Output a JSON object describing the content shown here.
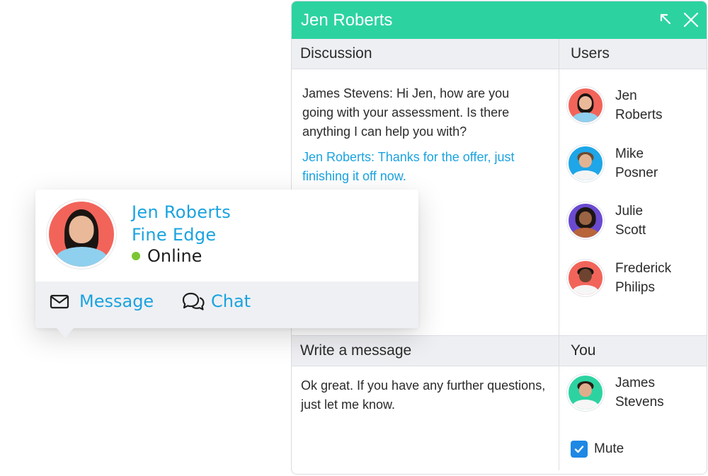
{
  "window": {
    "title": "Jen Roberts",
    "accent_color": "#2cd3a1",
    "icons": [
      "collapse-icon",
      "close-icon"
    ]
  },
  "discussion": {
    "header": "Discussion",
    "messages": [
      {
        "sender": "James Stevens",
        "text": "James Stevens: Hi Jen, how are you going with your assessment. Is there anything I can help you with?"
      },
      {
        "sender": "Jen Roberts",
        "text": "Jen Roberts: Thanks for the offer, just finishing it off now."
      }
    ]
  },
  "users": {
    "header": "Users",
    "items": [
      {
        "first": "Jen",
        "last": "Roberts",
        "avatar_bg": "#f2645a"
      },
      {
        "first": "Mike",
        "last": "Posner",
        "avatar_bg": "#1ea6e8"
      },
      {
        "first": "Julie",
        "last": "Scott",
        "avatar_bg": "#6a4ad0"
      },
      {
        "first": "Frederick",
        "last": "Philips",
        "avatar_bg": "#f2645a"
      }
    ]
  },
  "compose": {
    "header": "Write a message",
    "text": "Ok great. If you have any further questions, just let me know."
  },
  "you": {
    "header": "You",
    "first": "James",
    "last": "Stevens",
    "avatar_bg": "#2cd3a1",
    "mute_label": "Mute",
    "mute_checked": true
  },
  "profile_card": {
    "name": "Jen Roberts",
    "company": "Fine Edge",
    "status": "Online",
    "status_color": "#7cc634",
    "actions": [
      {
        "label": "Message",
        "icon": "envelope-icon"
      },
      {
        "label": "Chat",
        "icon": "chat-bubbles-icon"
      }
    ]
  }
}
